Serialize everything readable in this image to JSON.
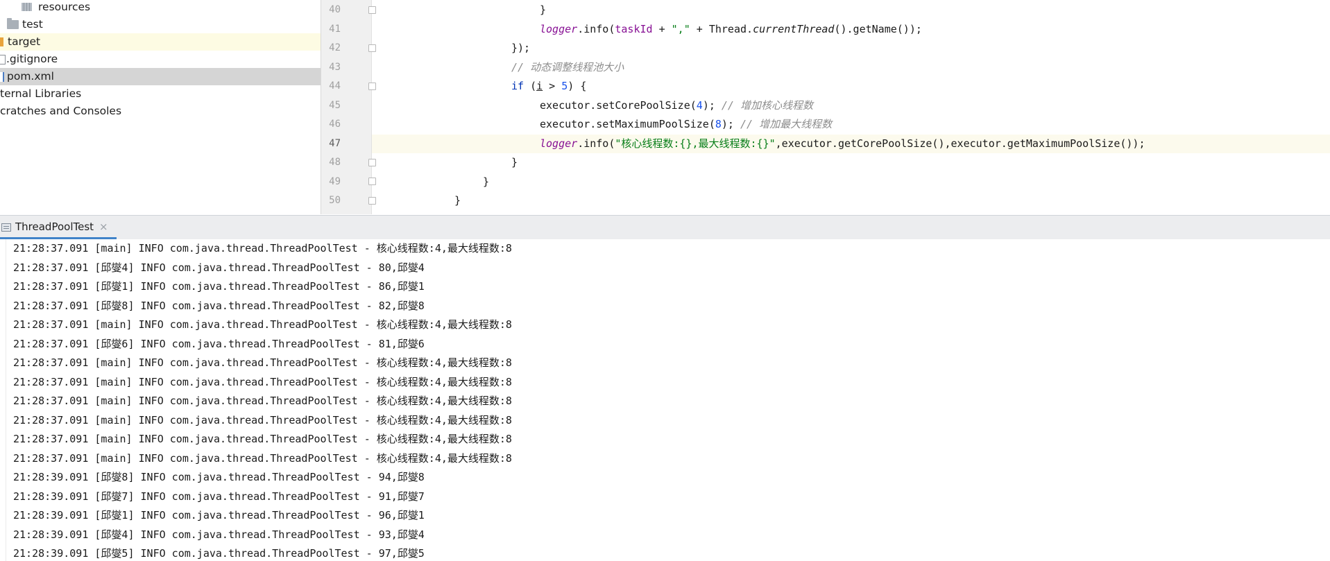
{
  "project_tree": {
    "items": [
      {
        "label": "resources",
        "icon": "resources-folder-icon"
      },
      {
        "label": "test",
        "icon": "folder-icon"
      },
      {
        "label": "target",
        "icon": "excluded-folder-icon"
      },
      {
        "label": ".gitignore",
        "icon": "gitignore-file-icon"
      },
      {
        "label": "pom.xml",
        "icon": "maven-file-icon"
      },
      {
        "label": "ternal Libraries",
        "icon": ""
      },
      {
        "label": "cratches and Consoles",
        "icon": ""
      }
    ]
  },
  "editor": {
    "line_numbers": [
      "40",
      "41",
      "42",
      "43",
      "44",
      "45",
      "46",
      "47",
      "48",
      "49",
      "50"
    ],
    "active_line": "47",
    "code": {
      "l40": "}",
      "l41": {
        "a": "logger",
        "b": ".info(",
        "c": "taskId",
        "d": " + ",
        "e": "\",\"",
        "f": " + Thread.",
        "g": "currentThread",
        "h": "().getName());"
      },
      "l42": "});",
      "l43": "// 动态调整线程池大小",
      "l44": {
        "a": "if",
        "b": " (",
        "c": "i",
        "d": " > ",
        "e": "5",
        "f": ") {"
      },
      "l45": {
        "a": "executor.setCorePoolSize(",
        "b": "4",
        "c": "); ",
        "d": "// 增加核心线程数"
      },
      "l46": {
        "a": "executor.setMaximumPoolSize(",
        "b": "8",
        "c": "); ",
        "d": "// 增加最大线程数"
      },
      "l47": {
        "a": "logger",
        "b": ".info(",
        "c": "\"核心线程数:{},最大线程数:{}\"",
        "d": ",executor.getCorePoolSize(),executor.getMaximumPoolSize());"
      },
      "l48": "}",
      "l49": "}",
      "l50": "}"
    }
  },
  "run_panel": {
    "tab_label": "ThreadPoolTest",
    "close_glyph": "×",
    "lines": [
      "21:28:37.091 [main] INFO com.java.thread.ThreadPoolTest - 核心线程数:4,最大线程数:8",
      "21:28:37.091 [邱燮4] INFO com.java.thread.ThreadPoolTest - 80,邱燮4",
      "21:28:37.091 [邱燮1] INFO com.java.thread.ThreadPoolTest - 86,邱燮1",
      "21:28:37.091 [邱燮8] INFO com.java.thread.ThreadPoolTest - 82,邱燮8",
      "21:28:37.091 [main] INFO com.java.thread.ThreadPoolTest - 核心线程数:4,最大线程数:8",
      "21:28:37.091 [邱燮6] INFO com.java.thread.ThreadPoolTest - 81,邱燮6",
      "21:28:37.091 [main] INFO com.java.thread.ThreadPoolTest - 核心线程数:4,最大线程数:8",
      "21:28:37.091 [main] INFO com.java.thread.ThreadPoolTest - 核心线程数:4,最大线程数:8",
      "21:28:37.091 [main] INFO com.java.thread.ThreadPoolTest - 核心线程数:4,最大线程数:8",
      "21:28:37.091 [main] INFO com.java.thread.ThreadPoolTest - 核心线程数:4,最大线程数:8",
      "21:28:37.091 [main] INFO com.java.thread.ThreadPoolTest - 核心线程数:4,最大线程数:8",
      "21:28:37.091 [main] INFO com.java.thread.ThreadPoolTest - 核心线程数:4,最大线程数:8",
      "21:28:39.091 [邱燮8] INFO com.java.thread.ThreadPoolTest - 94,邱燮8",
      "21:28:39.091 [邱燮7] INFO com.java.thread.ThreadPoolTest - 91,邱燮7",
      "21:28:39.091 [邱燮1] INFO com.java.thread.ThreadPoolTest - 96,邱燮1",
      "21:28:39.091 [邱燮4] INFO com.java.thread.ThreadPoolTest - 93,邱燮4",
      "21:28:39.091 [邱燮5] INFO com.java.thread.ThreadPoolTest - 97,邱燮5"
    ]
  },
  "colors": {
    "keyword": "#0033b3",
    "number": "#1750eb",
    "string": "#067d17",
    "comment": "#8c8c8c",
    "field": "#871094",
    "tab_underline": "#4083c9",
    "caret_row": "#fcfaed",
    "selected_row": "#d5d5d5"
  }
}
